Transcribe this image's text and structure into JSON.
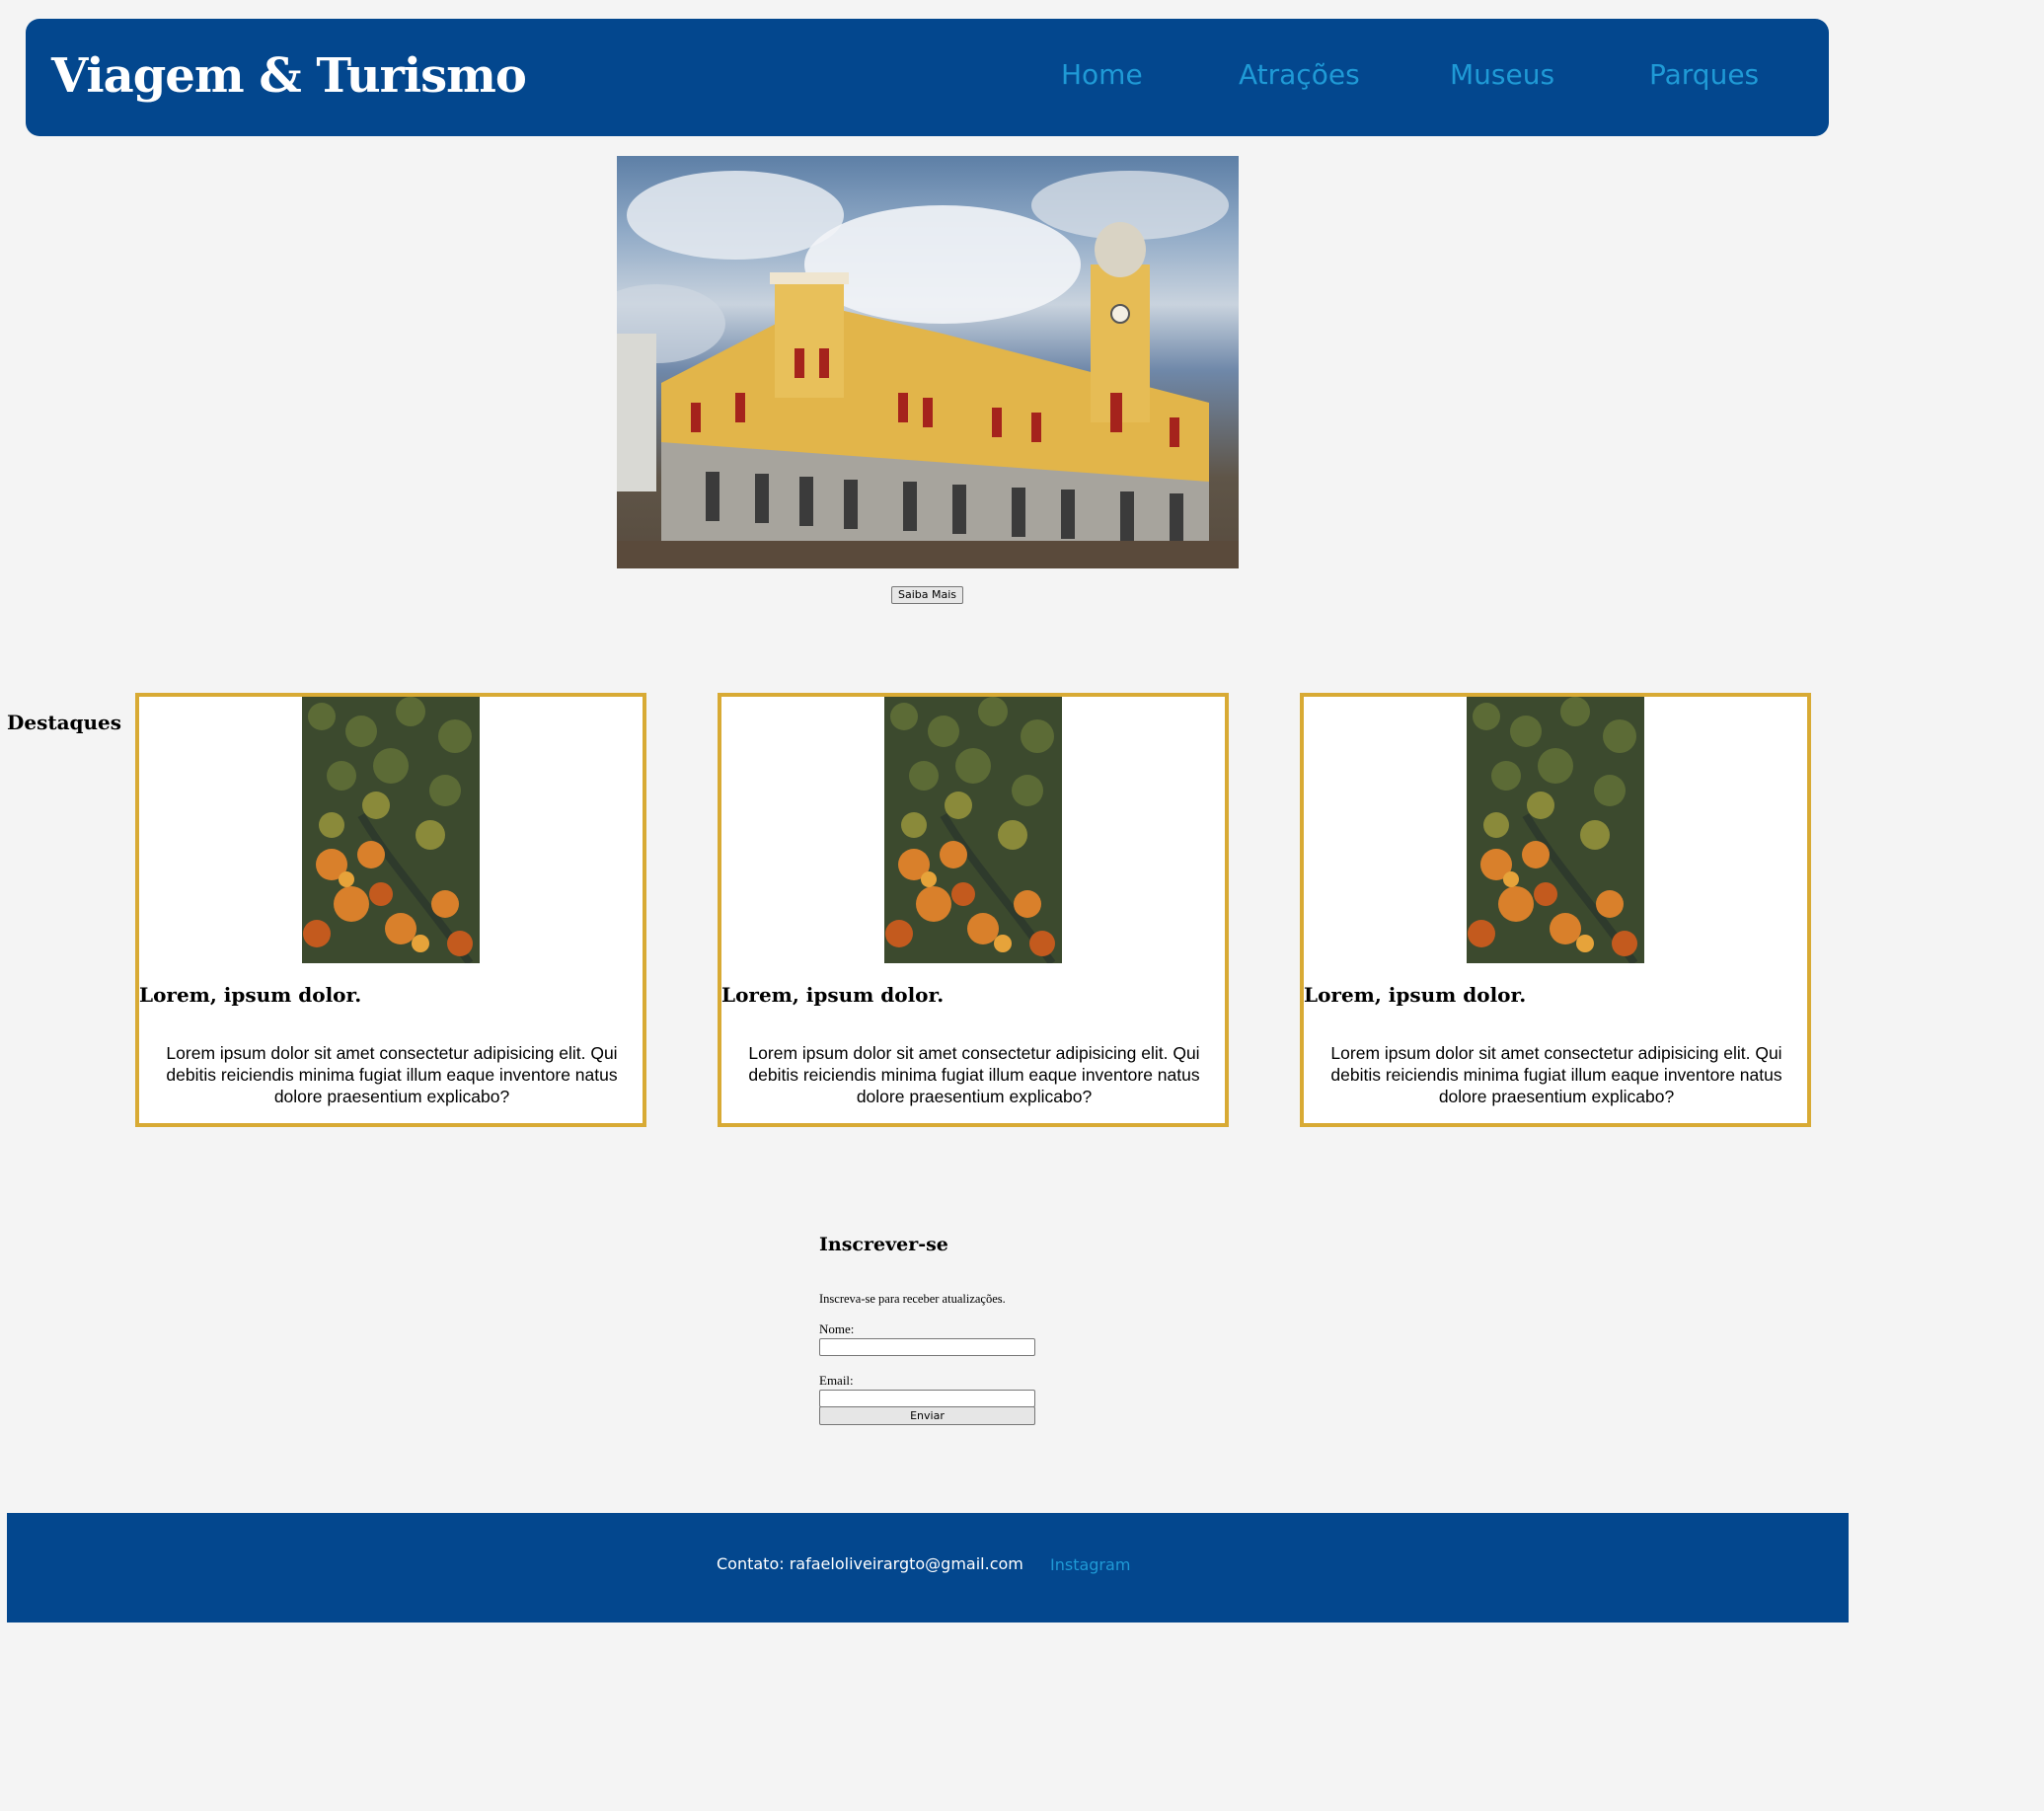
{
  "header": {
    "brand": "Viagem & Turismo",
    "nav": [
      {
        "label": "Home"
      },
      {
        "label": "Atrações"
      },
      {
        "label": "Museus"
      },
      {
        "label": "Parques"
      }
    ]
  },
  "hero": {
    "image": "historic-building-photo",
    "button_label": "Saiba Mais"
  },
  "highlights": {
    "title": "Destaques",
    "cards": [
      {
        "image": "forest-aerial-photo",
        "title": "Lorem, ipsum dolor.",
        "text": "Lorem ipsum dolor sit amet consectetur adipisicing elit. Qui debitis reiciendis minima fugiat illum eaque inventore natus dolore praesentium explicabo?"
      },
      {
        "image": "forest-aerial-photo",
        "title": "Lorem, ipsum dolor.",
        "text": "Lorem ipsum dolor sit amet consectetur adipisicing elit. Qui debitis reiciendis minima fugiat illum eaque inventore natus dolore praesentium explicabo?"
      },
      {
        "image": "forest-aerial-photo",
        "title": "Lorem, ipsum dolor.",
        "text": "Lorem ipsum dolor sit amet consectetur adipisicing elit. Qui debitis reiciendis minima fugiat illum eaque inventore natus dolore praesentium explicabo?"
      }
    ]
  },
  "subscribe": {
    "title": "Inscrever-se",
    "description": "Inscreva-se para receber atualizações.",
    "name_label": "Nome:",
    "name_value": "",
    "email_label": "Email:",
    "email_value": "",
    "submit_label": "Enviar"
  },
  "footer": {
    "contact": "Contato: rafaeloliveirargto@gmail.com",
    "instagram": "Instagram"
  },
  "colors": {
    "header_bg": "#03478e",
    "link": "#1f9ad6",
    "card_border": "#d8aa34",
    "page_bg": "#f4f4f4"
  }
}
